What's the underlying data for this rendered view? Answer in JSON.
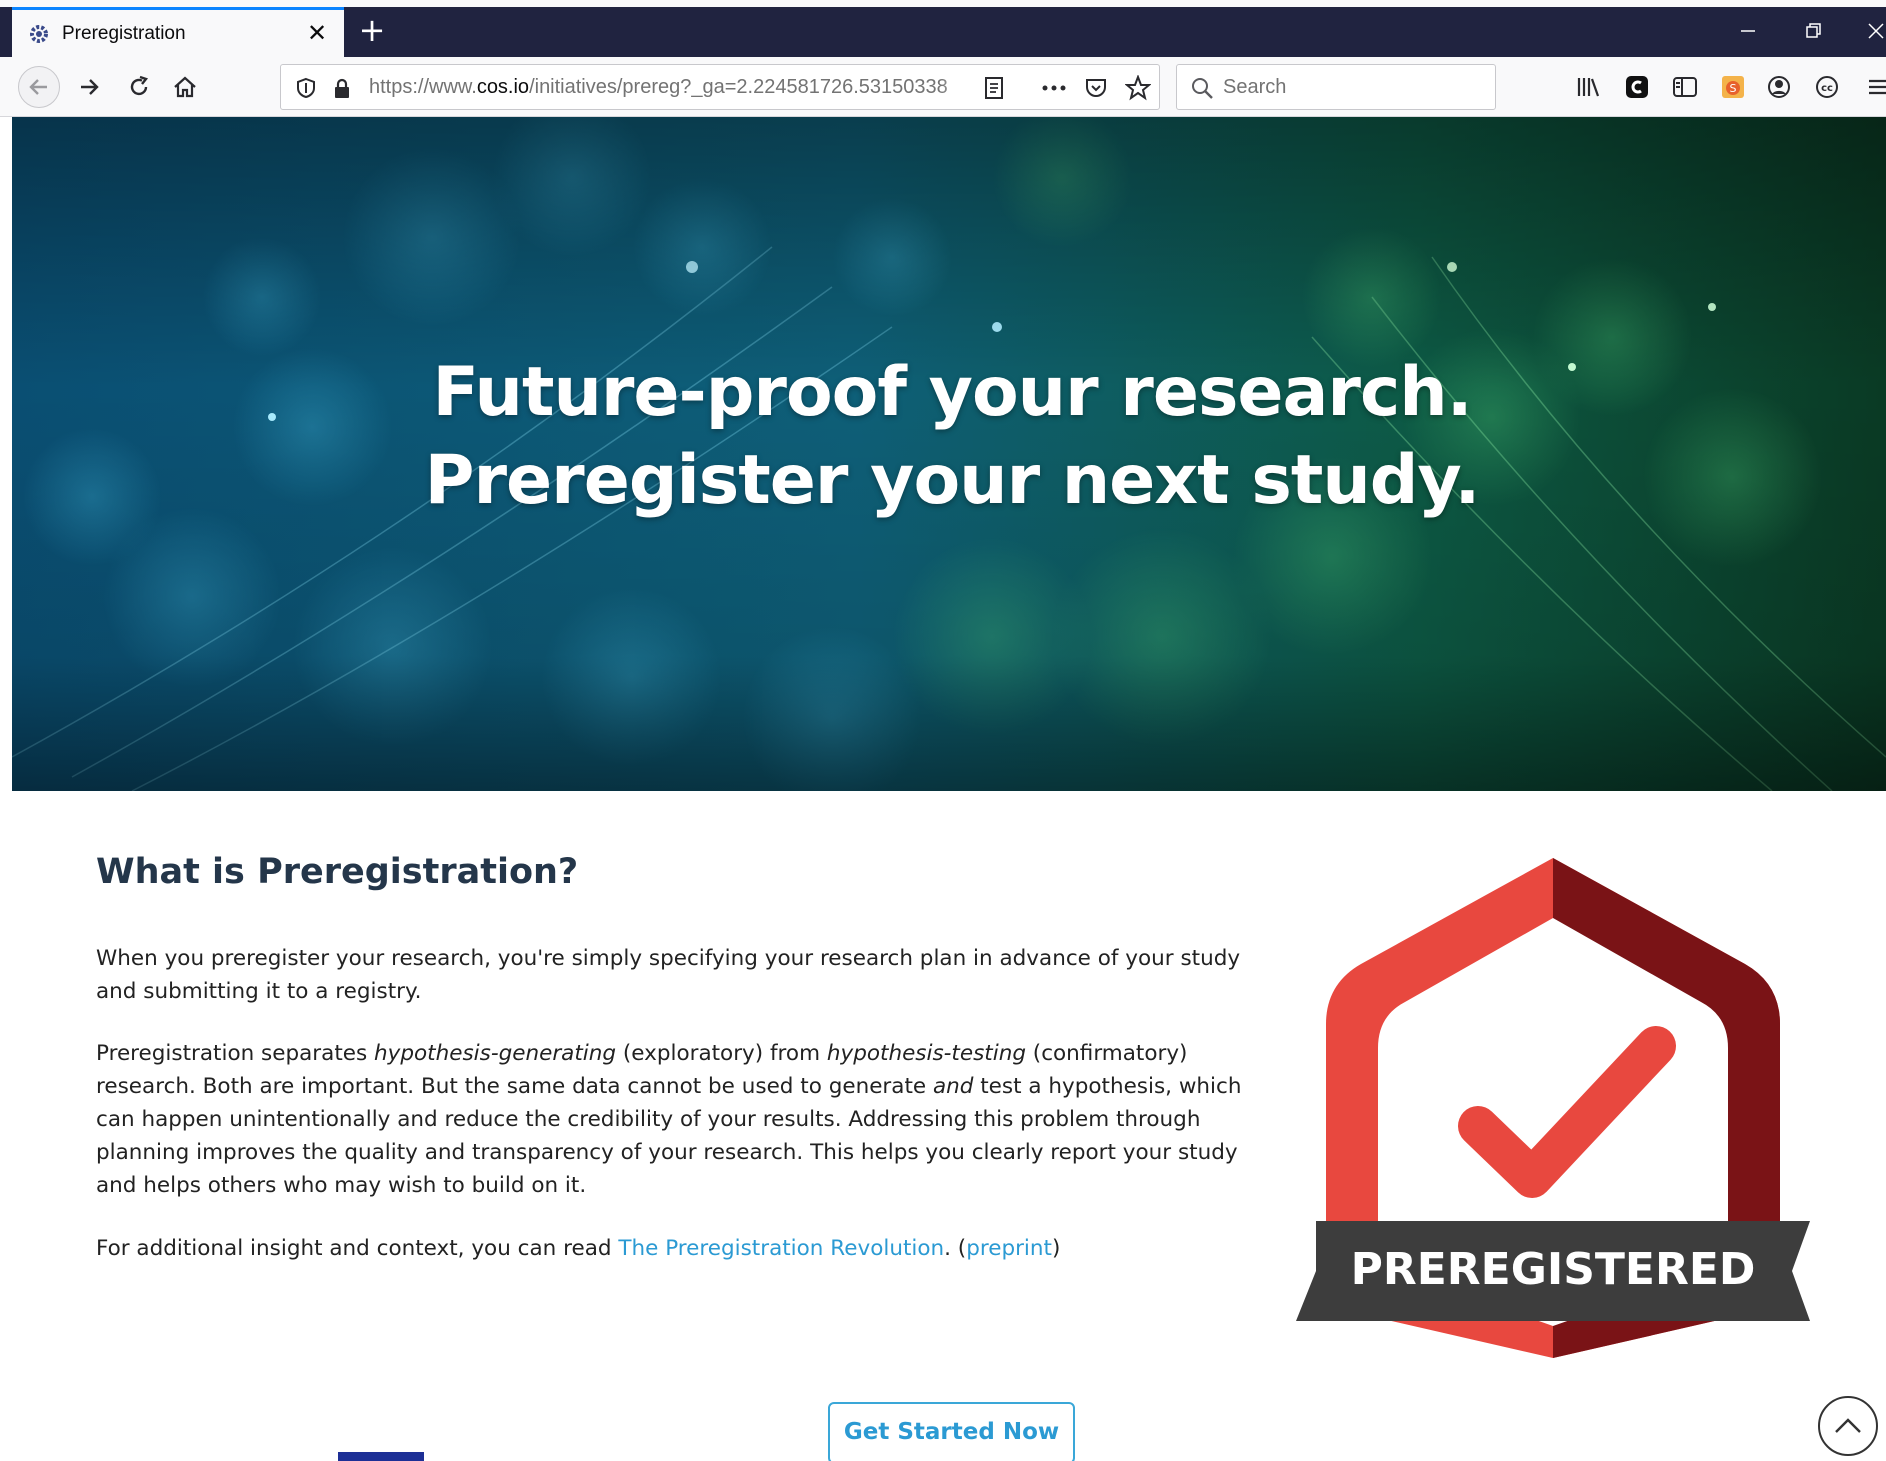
{
  "browser": {
    "tab_title": "Preregistration",
    "url_prefix": "https://www.",
    "url_domain": "cos.io",
    "url_path": "/initiatives/prereg?_ga=2.224581726.53150338",
    "search_placeholder": "Search",
    "accent_color": "#0a84ff",
    "titlebar_color": "#202340"
  },
  "hero": {
    "title_line1": "Future-proof your research.",
    "title_line2": "Preregister your next study."
  },
  "content": {
    "heading": "What is Preregistration?",
    "p1": "When you preregister your research, you're simply specifying your research plan in advance of your study and submitting it to a registry.",
    "p2_a": "Preregistration separates ",
    "p2_em1": "hypothesis-generating",
    "p2_b": "  (exploratory) from ",
    "p2_em2": "hypothesis-testing",
    "p2_c": " (confirmatory) research. Both are important. But the same data cannot be used to generate ",
    "p2_em3": "and",
    "p2_d": " test a hypothesis, which can happen unintentionally and reduce the credibility of your results. Addressing this problem through planning improves the quality and transparency of your research. This helps you clearly report your study and helps others who may wish to build on it.",
    "p3_a": "For additional insight and context, you can read ",
    "p3_link1": "The Preregistration Revolution",
    "p3_b": ". (",
    "p3_link2": "preprint",
    "p3_c": ")",
    "link_color": "#2b9ad3"
  },
  "badge": {
    "label": "PREREGISTERED",
    "color_red": "#e8483f",
    "color_dark_red": "#7a1316",
    "color_banner": "#3d3d3d"
  },
  "cta": {
    "label": "Get Started Now"
  }
}
